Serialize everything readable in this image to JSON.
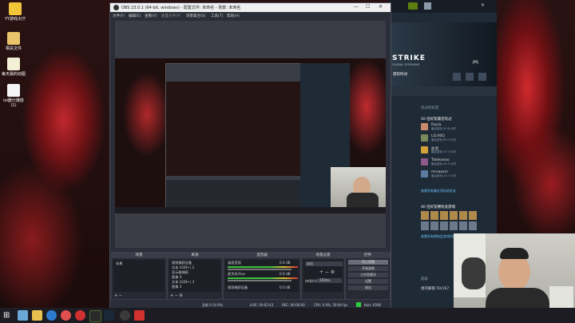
{
  "desktop": {
    "icons": [
      {
        "label": "YY游戏大厅"
      },
      {
        "label": "相关文件"
      },
      {
        "label": "每天晨的动图"
      },
      {
        "label": "ioi器分播放 (1)"
      }
    ]
  },
  "obs": {
    "title": "OBS 23.0.1 (64-bit, windows) - 配置文件: 未命名 - 场景: 未命名",
    "menu": [
      "文件(F)",
      "编辑(E)",
      "查看(V)",
      "配置文件(P)",
      "场景集合(S)",
      "工具(T)",
      "帮助(H)"
    ],
    "docks": {
      "scenes": {
        "title": "场景",
        "items": [
          "场景"
        ]
      },
      "sources": {
        "title": "来源",
        "items": [
          "视频捕获设备",
          "文本 (GDI+) 2",
          "显示器捕获",
          "图像 4",
          "文本 (GDI+) 3",
          "图像 3"
        ]
      },
      "mixer": {
        "title": "混音器",
        "channels": [
          {
            "name": "桌面音频",
            "db": "0.0 dB"
          },
          {
            "name": "麦克风/Aux",
            "db": "0.0 dB"
          },
          {
            "name": "视频捕获设备",
            "db": "0.0 dB"
          }
        ]
      },
      "transitions": {
        "title": "场景过渡",
        "type": "淡出",
        "duration_label": "持续时间",
        "duration": "250ms"
      },
      "controls": {
        "title": "控件",
        "buttons": [
          "停止直播",
          "开始录制",
          "工作室模式",
          "设置",
          "退出"
        ]
      }
    },
    "status": {
      "dropped": "丢帧 0 (0.0%)",
      "live": "LIVE: 00:02:43",
      "rec": "REC: 00:00:00",
      "cpu": "CPU: 0.9%, 59.94 fps",
      "kbps": "kb/s: 6590"
    }
  },
  "steam": {
    "game_title": "STRIKE",
    "game_sub": "GLOBAL OFFENSIVE",
    "play_time_label": "游玩时间",
    "recent_label": "玩过的好友",
    "recent_count": "10 位好友最近玩过",
    "friends": [
      {
        "name": "Rayla",
        "sub": "最近游玩 50.8 小时"
      },
      {
        "name": "LQ.00Q",
        "sub": "最近游玩 59.3 小时"
      },
      {
        "name": "血泪",
        "sub": "最近游玩 47.3 小时"
      },
      {
        "name": "Tatokoooo",
        "sub": "最近游玩 44.3 小时"
      },
      {
        "name": "mrsaasm",
        "sub": "最近游玩 23.7 小时"
      }
    ],
    "more_label": "查看所有最近游玩的好友",
    "owned_count": "40 位好友拥有此游戏",
    "owned_more": "查看所有拥有此游戏的好友",
    "section_label": "成就",
    "footer": "组内解锁 50/167"
  },
  "taskbar": {
    "icons": [
      "windows-icon",
      "task-view-icon",
      "explorer-icon",
      "edge-icon",
      "browser-icon",
      "netease-icon",
      "game-icon",
      "steam-icon",
      "obs-icon",
      "wps-icon"
    ]
  }
}
